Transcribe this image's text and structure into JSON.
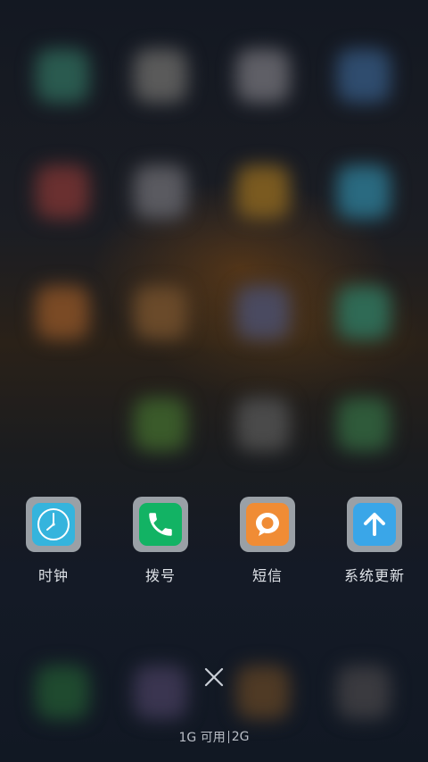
{
  "dock_apps": [
    {
      "label": "时钟",
      "icon": "clock-icon",
      "color": "#35b4dd"
    },
    {
      "label": "拨号",
      "icon": "phone-icon",
      "color": "#12b364"
    },
    {
      "label": "短信",
      "icon": "message-icon",
      "color": "#f08c35"
    },
    {
      "label": "系统更新",
      "icon": "update-arrow-icon",
      "color": "#3aa6e8"
    }
  ],
  "close_icon": "close-icon",
  "memory": {
    "free": "1G 可用",
    "total": "2G"
  },
  "colors": {
    "background": "#151a24",
    "icon_frame": "#9aa0a6",
    "label_text": "#dfe3e8"
  }
}
